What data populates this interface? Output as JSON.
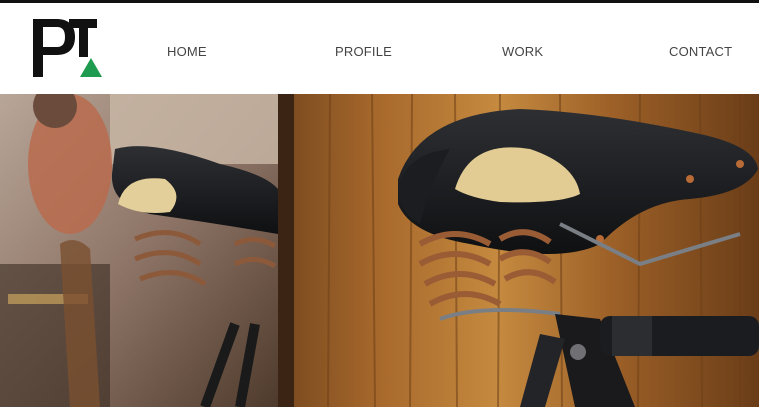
{
  "brand": {
    "logo_text": "PT",
    "accent_color": "#1e9b4e"
  },
  "nav": {
    "items": [
      {
        "label": "HOME"
      },
      {
        "label": "PROFILE"
      },
      {
        "label": "WORK"
      },
      {
        "label": "CONTACT"
      }
    ]
  },
  "hero": {
    "subject": "vintage leather bicycle saddle with coil springs, reflected in a mirror"
  },
  "colors": {
    "text": "#444444",
    "topbar": "#111111",
    "background": "#ffffff"
  }
}
